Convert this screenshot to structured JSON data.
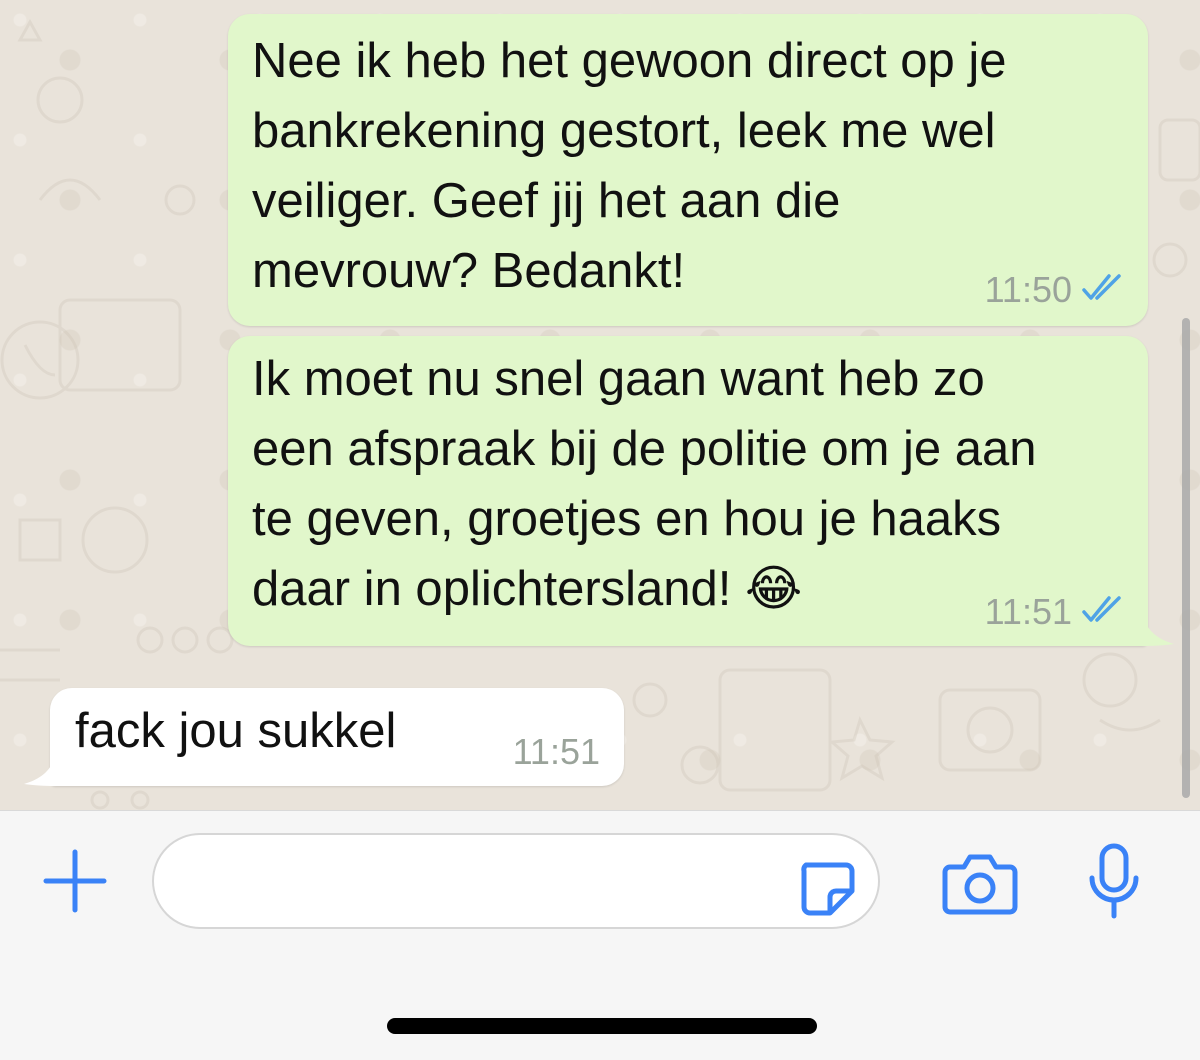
{
  "messages": [
    {
      "direction": "outgoing",
      "text": "Nee ik heb het gewoon direct op je\nbankrekening gestort, leek me wel\nveiliger. Geef jij het aan die\nmevrouw? Bedankt!",
      "time": "11:50",
      "status": "read"
    },
    {
      "direction": "outgoing",
      "text": "Ik moet nu snel gaan want heb zo\neen afspraak bij de politie om je aan\nte geven, groetjes en hou je haaks\ndaar in oplichtersland! 😂",
      "time": "11:51",
      "status": "read"
    },
    {
      "direction": "incoming",
      "text": "fack jou sukkel",
      "time": "11:51"
    }
  ],
  "composer": {
    "message_value": "",
    "icons": [
      "plus-icon",
      "sticker-icon",
      "camera-icon",
      "microphone-icon"
    ]
  },
  "colors": {
    "outgoing_bubble": "#e1f7cb",
    "incoming_bubble": "#ffffff",
    "accent": "#3a82f7",
    "read_ticks": "#4fa3e6",
    "chat_background": "#e9e3da"
  }
}
